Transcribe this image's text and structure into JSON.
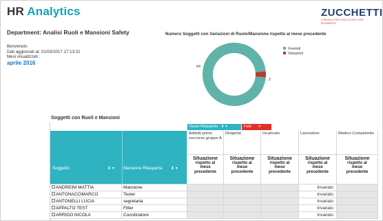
{
  "header": {
    "title_hr": "HR",
    "title_analytics": "Analytics",
    "logo_word": "ZUCCHETTI",
    "logo_tagline": "CONSULTING SOLUTION FOR BUSINESS"
  },
  "department": "Department: Analisi Ruoli e Mansioni Safety",
  "info": {
    "welcome": "Benvenuto",
    "updated": "Dati aggiornati al: 01/03/2017 17:13:31",
    "months_label": "Mesi visualizzati :",
    "period": "aprile 2016"
  },
  "chart_data": {
    "type": "pie",
    "title": "Numero Soggetti con Variazioni di Ruolo/Mansione rispetto al mese precedente",
    "labels": [
      "Invariati",
      "Variazioni"
    ],
    "values": [
      64,
      2
    ],
    "colors": [
      "#5fb3a8",
      "#c0392b"
    ],
    "legend": "right",
    "donut": true
  },
  "table": {
    "title": "Soggetti con Ruoli e Mansioni",
    "filters": {
      "ruolo": "Ruolo Rilasperto",
      "ruolo_icons": "⬇ ▾",
      "fatti": "Fatti",
      "fatti_icon": "▾"
    },
    "col_soggetto": "Soggetto",
    "col_mansione": "Mansione Rilasperta",
    "sort_icons": "⬇ ▾",
    "roles": [
      "Addetti primo soccorso gruppo A",
      "Dirigente",
      "Incaricato",
      "Lavoratore",
      "Medico Competente"
    ],
    "situazione": {
      "line1": "Situazione",
      "line2": "rispetto al",
      "line3": "mese",
      "line4": "precedente"
    },
    "rows": [
      {
        "name": "ANDREINI MATTIA",
        "mansione": "Mansione",
        "lavoratore": "Invariato"
      },
      {
        "name": "ANTONACCIMARCO",
        "mansione": "Tester",
        "lavoratore": "Invariato"
      },
      {
        "name": "ANTONELLI LUCIA",
        "mansione": "segretaria",
        "lavoratore": "Invariato"
      },
      {
        "name": "APPALTO TEST",
        "mansione": "Fitter",
        "lavoratore": "Invariato"
      },
      {
        "name": "ARRIGO NICOLA",
        "mansione": "Coordinatore",
        "lavoratore": "Invariato"
      }
    ]
  }
}
